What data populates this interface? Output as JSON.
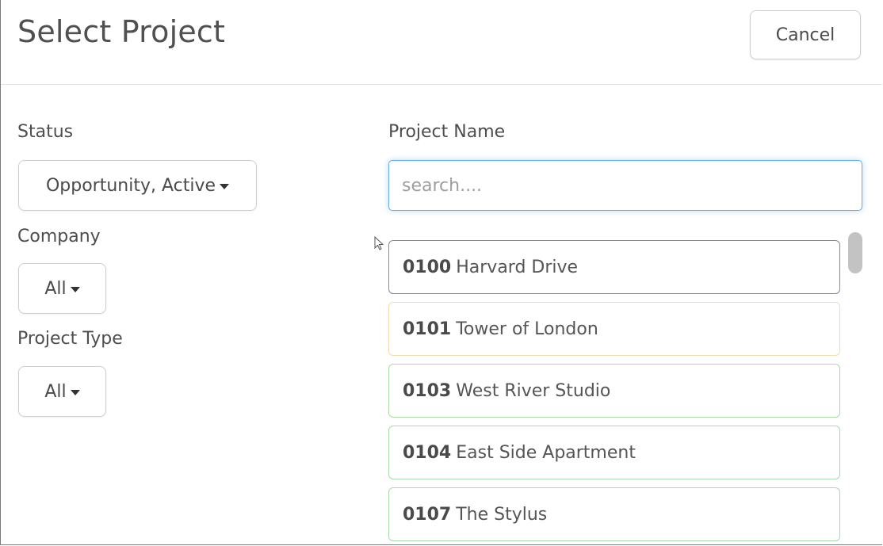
{
  "header": {
    "title": "Select Project",
    "cancel_label": "Cancel"
  },
  "filters": {
    "status": {
      "label": "Status",
      "value": "Opportunity, Active"
    },
    "company": {
      "label": "Company",
      "value": "All"
    },
    "project_type": {
      "label": "Project Type",
      "value": "All"
    }
  },
  "search": {
    "label": "Project Name",
    "placeholder": "search....",
    "value": ""
  },
  "projects": [
    {
      "number": "0100",
      "name": "Harvard Drive",
      "border_color": "#8a8a8a"
    },
    {
      "number": "0101",
      "name": "Tower of London",
      "border_color": "#f3dcb0"
    },
    {
      "number": "0103",
      "name": "West River Studio",
      "border_color": "#a8dba8"
    },
    {
      "number": "0104",
      "name": "East Side Apartment",
      "border_color": "#a8dba8"
    },
    {
      "number": "0107",
      "name": "The Stylus",
      "border_color": "#a8dba8"
    }
  ],
  "colors": {
    "focus_border": "#66afe9",
    "scroll_thumb": "#c3c3c3"
  }
}
